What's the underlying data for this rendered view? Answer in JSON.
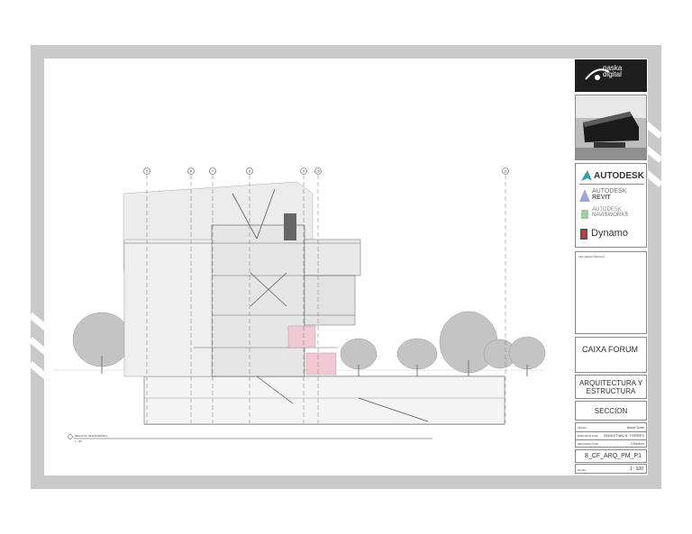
{
  "company": {
    "name_line1": "naska",
    "name_line2": "digital"
  },
  "software": {
    "autodesk": "AUTODESK",
    "revit_brand": "AUTODESK",
    "revit_product": "REVIT",
    "navisworks_brand": "AUTODESK",
    "navisworks_product": "NAVISWORKS",
    "dynamo": "Dynamo"
  },
  "info": {
    "additional_label": "Información Adicional"
  },
  "project": {
    "name": "CAIXA FORUM",
    "discipline_line1": "ARQUITECTURA Y",
    "discipline_line2": "ESTRUCTURA",
    "view": "SECCION"
  },
  "fields": {
    "date_label": "FECHA",
    "date_value": "Issue Date",
    "drawn_label": "DIBUJADO POR",
    "drawn_value": "SEBASTIAN N. TORRES",
    "reviewed_label": "REVISADO POR",
    "reviewed_value": "Checker",
    "sheet_code": "8_CF_ARQ_PM_P1",
    "scale_label": "Escala",
    "scale_value": "1 : 100"
  },
  "drawing": {
    "section_label": "SECCION TRANSVERSAL",
    "section_scale": "1 : 100",
    "grid_labels": [
      "5",
      "6",
      "7",
      "8",
      "9",
      "10",
      "11"
    ]
  }
}
